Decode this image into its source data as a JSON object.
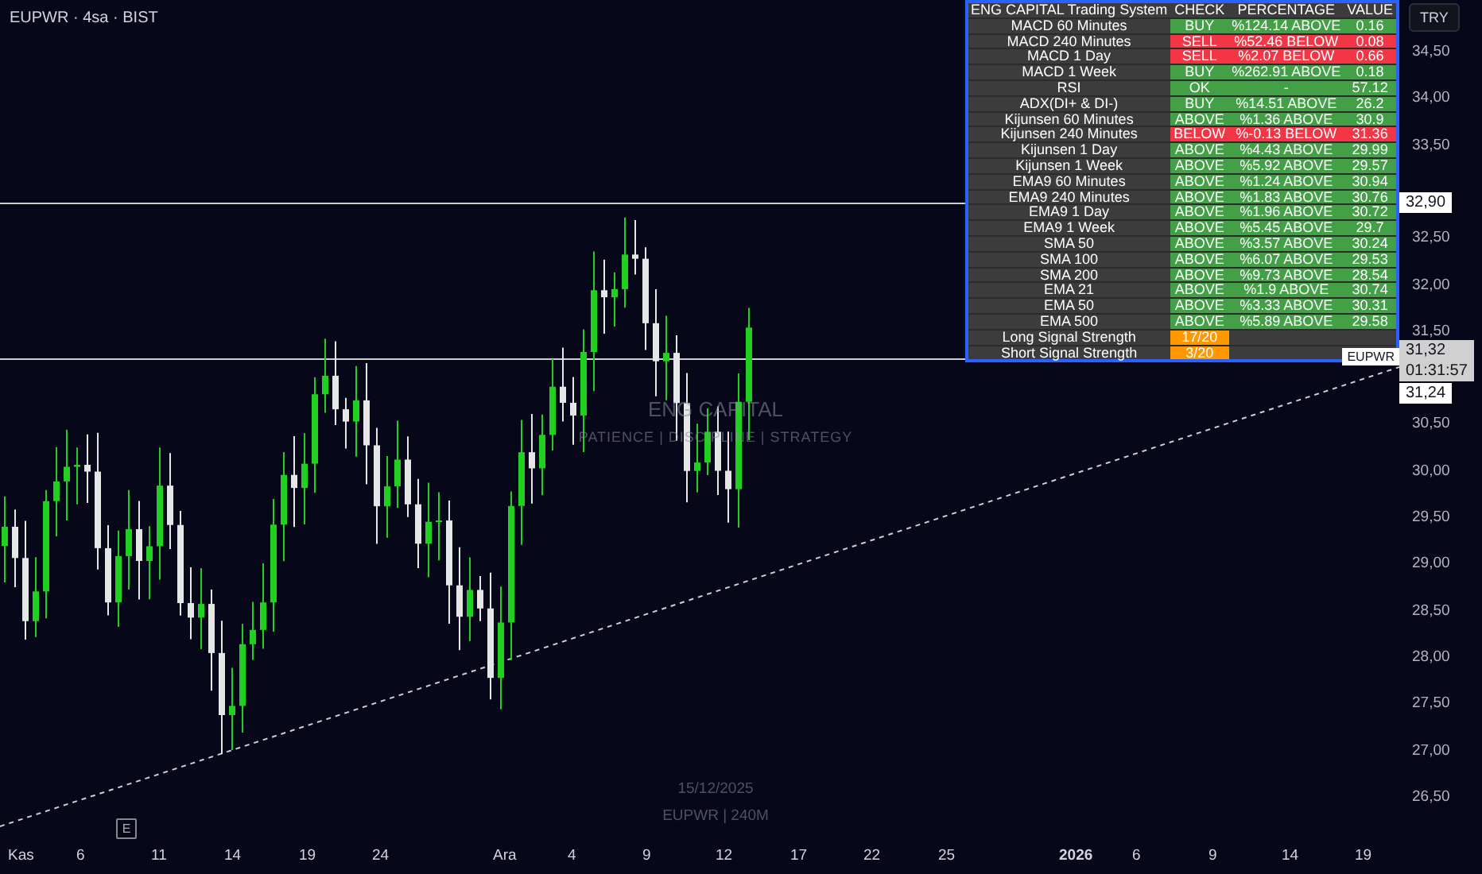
{
  "header": {
    "symbol": "EUPWR · 4sa · BIST"
  },
  "currency_button": "TRY",
  "price_axis": [
    "34,50",
    "34,00",
    "33,50",
    "32,50",
    "32,00",
    "31,50",
    "30,50",
    "30,00",
    "29,50",
    "29,00",
    "28,50",
    "28,00",
    "27,50",
    "27,00",
    "26,50"
  ],
  "price_badges": {
    "upper_line": "32,90",
    "last_price": "31,32",
    "countdown": "01:31:57",
    "lower_line": "31,24",
    "symbol_tag": "EUPWR"
  },
  "time_axis": [
    {
      "label": "Kas",
      "kind": "month"
    },
    {
      "label": "6",
      "kind": "day"
    },
    {
      "label": "11",
      "kind": "day"
    },
    {
      "label": "14",
      "kind": "day"
    },
    {
      "label": "19",
      "kind": "day"
    },
    {
      "label": "24",
      "kind": "day"
    },
    {
      "label": "Ara",
      "kind": "month"
    },
    {
      "label": "4",
      "kind": "day"
    },
    {
      "label": "9",
      "kind": "day"
    },
    {
      "label": "12",
      "kind": "day"
    },
    {
      "label": "17",
      "kind": "day"
    },
    {
      "label": "22",
      "kind": "day"
    },
    {
      "label": "25",
      "kind": "day"
    },
    {
      "label": "2026",
      "kind": "year"
    },
    {
      "label": "6",
      "kind": "day"
    },
    {
      "label": "9",
      "kind": "day"
    },
    {
      "label": "14",
      "kind": "day"
    },
    {
      "label": "19",
      "kind": "day"
    }
  ],
  "event_marker": "E",
  "chart_watermark": {
    "title": "ENG CAPITAL",
    "subtitle": "PATIENCE | DISCIPLINE | STRATEGY",
    "date": "15/12/2025",
    "symbol": "EUPWR | 240M"
  },
  "signal_table": {
    "columns": [
      "ENG CAPITAL Trading System",
      "CHECK",
      "PERCENTAGE",
      "VALUE"
    ],
    "rows": [
      {
        "name": "MACD 60 Minutes",
        "check": "BUY",
        "percentage": "%124.14 ABOVE",
        "value": "0.16",
        "color": "#43a047"
      },
      {
        "name": "MACD 240 Minutes",
        "check": "SELL",
        "percentage": "%52.46 BELOW",
        "value": "0.08",
        "color": "#f23645"
      },
      {
        "name": "MACD 1 Day",
        "check": "SELL",
        "percentage": "%2.07 BELOW",
        "value": "0.66",
        "color": "#f23645"
      },
      {
        "name": "MACD 1 Week",
        "check": "BUY",
        "percentage": "%262.91 ABOVE",
        "value": "0.18",
        "color": "#43a047"
      },
      {
        "name": "RSI",
        "check": "OK",
        "percentage": "-",
        "value": "57.12",
        "color": "#43a047"
      },
      {
        "name": "ADX(DI+ & DI-)",
        "check": "BUY",
        "percentage": "%14.51 ABOVE",
        "value": "26.2",
        "color": "#43a047"
      },
      {
        "name": "Kijunsen 60 Minutes",
        "check": "ABOVE",
        "percentage": "%1.36 ABOVE",
        "value": "30.9",
        "color": "#43a047"
      },
      {
        "name": "Kijunsen 240 Minutes",
        "check": "BELOW",
        "percentage": "%-0.13 BELOW",
        "value": "31.36",
        "color": "#f23645"
      },
      {
        "name": "Kijunsen 1 Day",
        "check": "ABOVE",
        "percentage": "%4.43 ABOVE",
        "value": "29.99",
        "color": "#43a047"
      },
      {
        "name": "Kijunsen 1 Week",
        "check": "ABOVE",
        "percentage": "%5.92 ABOVE",
        "value": "29.57",
        "color": "#43a047"
      },
      {
        "name": "EMA9 60 Minutes",
        "check": "ABOVE",
        "percentage": "%1.24 ABOVE",
        "value": "30.94",
        "color": "#43a047"
      },
      {
        "name": "EMA9 240 Minutes",
        "check": "ABOVE",
        "percentage": "%1.83 ABOVE",
        "value": "30.76",
        "color": "#43a047"
      },
      {
        "name": "EMA9 1 Day",
        "check": "ABOVE",
        "percentage": "%1.96 ABOVE",
        "value": "30.72",
        "color": "#43a047"
      },
      {
        "name": "EMA9 1 Week",
        "check": "ABOVE",
        "percentage": "%5.45 ABOVE",
        "value": "29.7",
        "color": "#43a047"
      },
      {
        "name": "SMA 50",
        "check": "ABOVE",
        "percentage": "%3.57 ABOVE",
        "value": "30.24",
        "color": "#43a047"
      },
      {
        "name": "SMA 100",
        "check": "ABOVE",
        "percentage": "%6.07 ABOVE",
        "value": "29.53",
        "color": "#43a047"
      },
      {
        "name": "SMA 200",
        "check": "ABOVE",
        "percentage": "%9.73 ABOVE",
        "value": "28.54",
        "color": "#43a047"
      },
      {
        "name": "EMA 21",
        "check": "ABOVE",
        "percentage": "%1.9 ABOVE",
        "value": "30.74",
        "color": "#43a047"
      },
      {
        "name": "EMA 50",
        "check": "ABOVE",
        "percentage": "%3.33 ABOVE",
        "value": "30.31",
        "color": "#43a047"
      },
      {
        "name": "EMA 500",
        "check": "ABOVE",
        "percentage": "%5.89 ABOVE",
        "value": "29.58",
        "color": "#43a047"
      },
      {
        "name": "Long Signal Strength",
        "check": "17/20",
        "color": "#ff9800"
      },
      {
        "name": "Short Signal Strength",
        "check": "3/20",
        "color": "#ff9800"
      }
    ]
  }
}
